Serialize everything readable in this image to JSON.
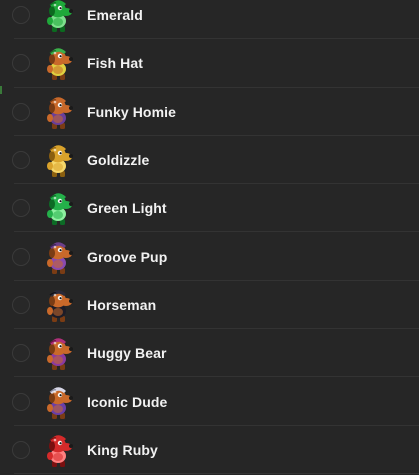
{
  "items": [
    {
      "label": "Emerald",
      "icon": "emerald-character-icon",
      "body": "#1fa83a",
      "dark": "#0b6a1f",
      "hat": "#1fa83a",
      "hat_dark": "#0b6a1f",
      "accent": "#7ee08d"
    },
    {
      "label": "Fish Hat",
      "icon": "fish-hat-character-icon",
      "body": "#c9692a",
      "dark": "#7a3c14",
      "hat": "#3bb14a",
      "hat_dark": "#1d6a26",
      "accent": "#e0d040"
    },
    {
      "label": "Funky Homie",
      "icon": "funky-homie-character-icon",
      "body": "#c9692a",
      "dark": "#7a3c14",
      "hat": "#c9692a",
      "hat_dark": "#7a3c14",
      "accent": "#6a3e9a"
    },
    {
      "label": "Goldizzle",
      "icon": "goldizzle-character-icon",
      "body": "#d9a22b",
      "dark": "#8a5f10",
      "hat": "#d9a22b",
      "hat_dark": "#8a5f10",
      "accent": "#f5d76a"
    },
    {
      "label": "Green Light",
      "icon": "green-light-character-icon",
      "body": "#24b04a",
      "dark": "#0c6b25",
      "hat": "#24b04a",
      "hat_dark": "#0c6b25",
      "accent": "#8ef0a0"
    },
    {
      "label": "Groove Pup",
      "icon": "groove-pup-character-icon",
      "body": "#c9692a",
      "dark": "#7a3c14",
      "hat": "#6b3f8a",
      "hat_dark": "#3a1f52",
      "accent": "#8a4ab0"
    },
    {
      "label": "Horseman",
      "icon": "horseman-character-icon",
      "body": "#c9692a",
      "dark": "#7a3c14",
      "hat": "#2a2a3a",
      "hat_dark": "#101018",
      "accent": "#1c1c28"
    },
    {
      "label": "Huggy Bear",
      "icon": "huggy-bear-character-icon",
      "body": "#c9692a",
      "dark": "#7a3c14",
      "hat": "#b0307a",
      "hat_dark": "#6a1446",
      "accent": "#8a3aa0"
    },
    {
      "label": "Iconic Dude",
      "icon": "iconic-dude-character-icon",
      "body": "#c9692a",
      "dark": "#7a3c14",
      "hat": "#d8d8e8",
      "hat_dark": "#8a8aa0",
      "accent": "#6a3ea8"
    },
    {
      "label": "King Ruby",
      "icon": "king-ruby-character-icon",
      "body": "#d42a2a",
      "dark": "#7a1010",
      "hat": "#d42a2a",
      "hat_dark": "#7a1010",
      "accent": "#ff8080"
    }
  ]
}
